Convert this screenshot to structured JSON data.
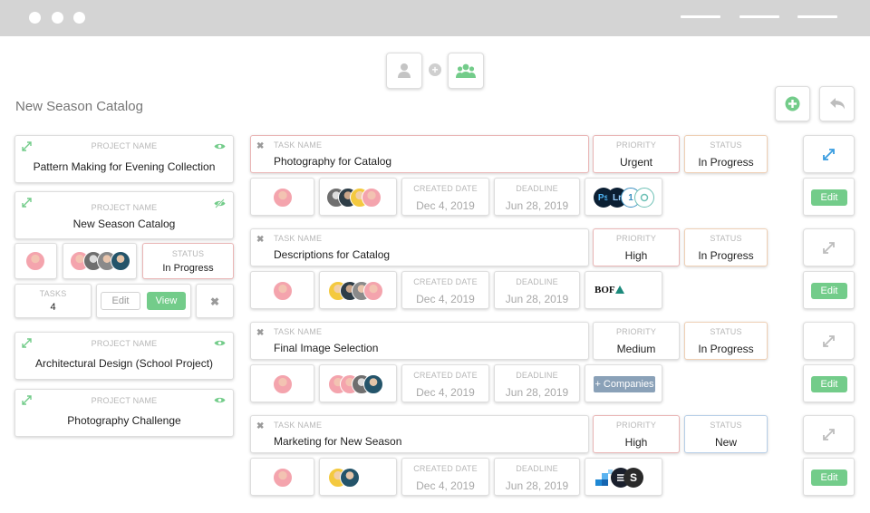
{
  "page_title": "New Season Catalog",
  "colors": {
    "accent_green": "#73cc8a",
    "expand_blue": "#3a9de0",
    "titlebar": "#d4d4d4"
  },
  "projects": [
    {
      "label": "PROJECT NAME",
      "name": "Pattern Making for Evening Collection"
    },
    {
      "label": "PROJECT NAME",
      "name": "New Season Catalog"
    },
    {
      "label": "PROJECT NAME",
      "name": "Architectural Design (School Project)"
    },
    {
      "label": "PROJECT NAME",
      "name": "Photography Challenge"
    }
  ],
  "selected_project": {
    "status_label": "STATUS",
    "status": "In Progress",
    "tasks_label": "TASKS",
    "tasks_count": "4",
    "edit_label": "Edit",
    "view_label": "View"
  },
  "tasks": [
    {
      "name_label": "TASK NAME",
      "name": "Photography for Catalog",
      "priority_label": "PRIORITY",
      "priority": "Urgent",
      "status_label": "STATUS",
      "status": "In Progress",
      "created_label": "CREATED DATE",
      "created": "Dec 4, 2019",
      "deadline_label": "DEADLINE",
      "deadline": "Jun 28, 2019",
      "edit_label": "Edit",
      "company_logos": [
        "Ps",
        "Lr",
        "1",
        "circle"
      ]
    },
    {
      "name_label": "TASK NAME",
      "name": "Descriptions for Catalog",
      "priority_label": "PRIORITY",
      "priority": "High",
      "status_label": "STATUS",
      "status": "In Progress",
      "created_label": "CREATED DATE",
      "created": "Dec 4, 2019",
      "deadline_label": "DEADLINE",
      "deadline": "Jun 28, 2019",
      "edit_label": "Edit",
      "company_logos": [
        "BOF"
      ]
    },
    {
      "name_label": "TASK NAME",
      "name": "Final Image Selection",
      "priority_label": "PRIORITY",
      "priority": "Medium",
      "status_label": "STATUS",
      "status": "In Progress",
      "created_label": "CREATED DATE",
      "created": "Dec 4, 2019",
      "deadline_label": "DEADLINE",
      "deadline": "Jun 28, 2019",
      "edit_label": "Edit",
      "companies_button": "+ Companies"
    },
    {
      "name_label": "TASK NAME",
      "name": "Marketing for New Season",
      "priority_label": "PRIORITY",
      "priority": "High",
      "status_label": "STATUS",
      "status": "New",
      "created_label": "CREATED DATE",
      "created": "Dec 4, 2019",
      "deadline_label": "DEADLINE",
      "deadline": "Jun 28, 2019",
      "edit_label": "Edit",
      "company_logos": [
        "blocks",
        "stack",
        "S"
      ]
    }
  ]
}
